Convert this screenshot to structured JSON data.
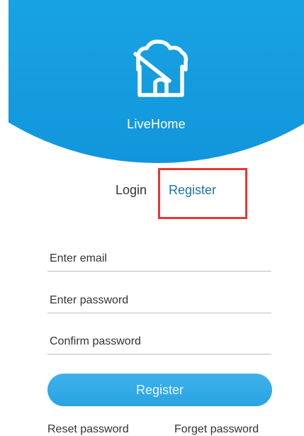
{
  "app": {
    "name": "LiveHome",
    "logo_icon": "cloud-house-icon"
  },
  "tabs": {
    "login_label": "Login",
    "register_label": "Register",
    "active": "Register"
  },
  "form": {
    "email_placeholder": "Enter email",
    "password_placeholder": "Enter password",
    "confirm_placeholder": "Confirm password",
    "email_value": "",
    "password_value": "",
    "confirm_value": ""
  },
  "submit": {
    "label": "Register"
  },
  "links": {
    "reset_label": "Reset password",
    "forget_label": "Forget password"
  },
  "colors": {
    "header_blue": "#1a9fe3",
    "button_blue": "#33aae6",
    "active_tab": "#1f6fa8",
    "highlight": "#e53935"
  }
}
